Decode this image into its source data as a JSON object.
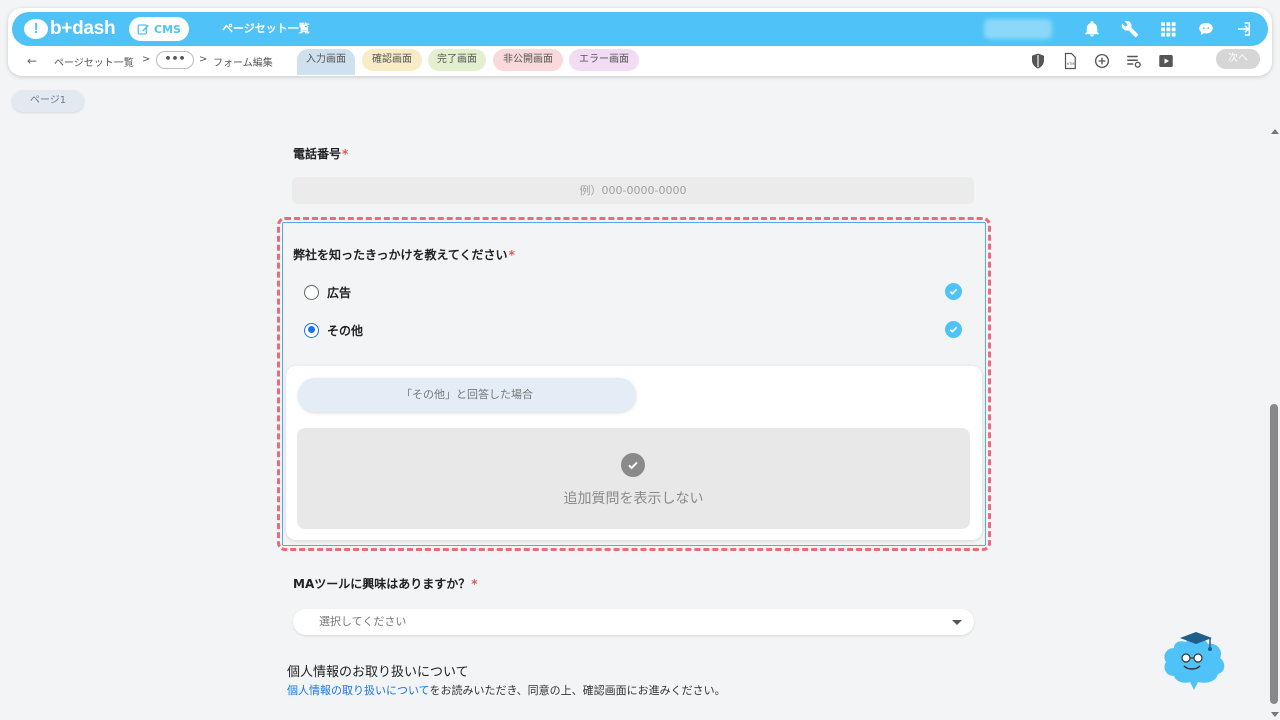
{
  "header": {
    "brand": "b+dash",
    "cms_label": "CMS",
    "title": "ページセット一覧",
    "icons": [
      "bell-icon",
      "wrench-icon",
      "grid-icon",
      "ai-chat-icon",
      "logout-icon"
    ]
  },
  "subbar": {
    "crumb_list": "ページセット一覧",
    "crumb_sep1": ">",
    "crumb_more": "•••",
    "crumb_sep2": ">",
    "crumb_current": "フォーム編集",
    "tabs": [
      {
        "label": "入力画面",
        "bg": "#cfe0ee"
      },
      {
        "label": "確認画面",
        "bg": "#f7ecc6"
      },
      {
        "label": "完了画面",
        "bg": "#e3f0cf"
      },
      {
        "label": "非公開画面",
        "bg": "#f9d9d9"
      },
      {
        "label": "エラー画面",
        "bg": "#f1dcf3"
      }
    ],
    "tools": [
      "shield-icon",
      "html-file-icon",
      "add-circle-icon",
      "list-settings-icon",
      "play-icon"
    ],
    "next_label": "次へ"
  },
  "page_tab": "ページ1",
  "form": {
    "phone": {
      "label": "電話番号",
      "required": "*",
      "placeholder": "例）000-0000-0000"
    },
    "source": {
      "label": "弊社を知ったきっかけを教えてください",
      "required": "*",
      "options": [
        {
          "label": "広告",
          "selected": false
        },
        {
          "label": "その他",
          "selected": true
        }
      ],
      "branch_label": "「その他」と回答した場合",
      "no_question_label": "追加質問を表示しない"
    },
    "ma": {
      "label": "MAツールに興味はありますか？",
      "required": "*",
      "placeholder": "選択してください"
    },
    "privacy": {
      "title": "個人情報のお取り扱いについて",
      "link": "個人情報の取り扱いについて",
      "text": "をお読みいただき、同意の上、確認画面にお進みください。"
    }
  },
  "colors": {
    "accent": "#4fc3f7",
    "selection_dash": "#e86c7a",
    "selection_inner": "#58a6e8",
    "required": "#e05656",
    "link": "#1a73e8"
  }
}
